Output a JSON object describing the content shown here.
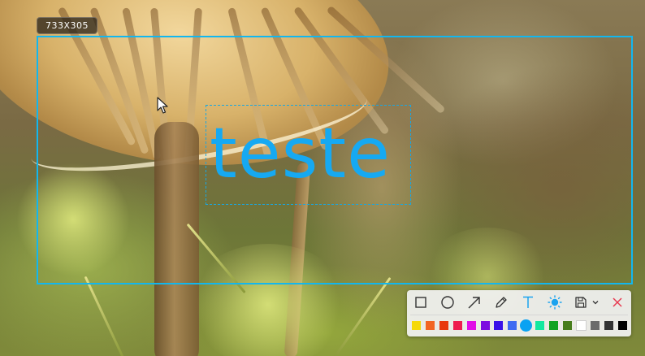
{
  "selection": {
    "size_label": "733X305",
    "border_color": "#12b7ef"
  },
  "annotation": {
    "text": "teste",
    "color": "#16a9f2"
  },
  "toolbar": {
    "tools": [
      {
        "name": "rectangle-icon"
      },
      {
        "name": "ellipse-icon"
      },
      {
        "name": "arrow-icon"
      },
      {
        "name": "pencil-icon"
      },
      {
        "name": "text-icon",
        "active": true
      },
      {
        "name": "blur-icon",
        "active": true
      },
      {
        "name": "save-icon"
      },
      {
        "name": "chevron-down-icon"
      },
      {
        "name": "close-icon"
      }
    ],
    "palette": [
      "#f5d90a",
      "#f26522",
      "#e8380d",
      "#ee1c4e",
      "#e10ee6",
      "#7d0de0",
      "#3a12e8",
      "#3f6af2",
      "#0aa2f2",
      "#12e8a0",
      "#0fa322",
      "#477d1c",
      "#ffffff",
      "#6b6b6b",
      "#333333",
      "#000000"
    ],
    "selected_color": "#0aa2f2"
  }
}
